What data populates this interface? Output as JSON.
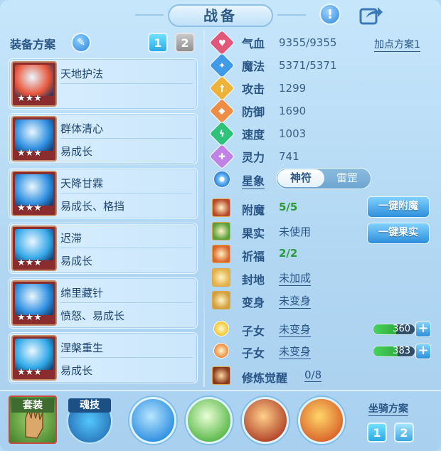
{
  "window": {
    "title": "战备"
  },
  "header": {
    "alert_icon": "exclamation-icon",
    "share_icon": "share-icon"
  },
  "left": {
    "scheme_label": "装备方案",
    "pages": [
      "1",
      "2"
    ],
    "skills": [
      {
        "name": "天地护法",
        "sub": "",
        "stars": "★★★",
        "color": "#e8553a"
      },
      {
        "name": "群体清心",
        "sub": "易成长",
        "stars": "★★★",
        "color": "#2f8fe0"
      },
      {
        "name": "天降甘霖",
        "sub": "易成长、格挡",
        "stars": "★★★",
        "color": "#2f8fe0"
      },
      {
        "name": "迟滞",
        "sub": "易成长",
        "stars": "★★★",
        "color": "#36a8e8"
      },
      {
        "name": "绵里藏针",
        "sub": "愤怒、易成长",
        "stars": "★★★",
        "color": "#2f8fe0"
      },
      {
        "name": "涅槃重生",
        "sub": "易成长",
        "stars": "★★★",
        "color": "#2fa8e8"
      }
    ]
  },
  "stats": {
    "plan_link": "加点方案1",
    "rows": [
      {
        "label": "气血",
        "value": "9355/9355",
        "color": "#e2587a",
        "glyph": "♥"
      },
      {
        "label": "魔法",
        "value": "5371/5371",
        "color": "#3f9ae8",
        "glyph": "✦"
      },
      {
        "label": "攻击",
        "value": "1299",
        "color": "#efb23a",
        "glyph": "†"
      },
      {
        "label": "防御",
        "value": "1690",
        "color": "#ee8d46",
        "glyph": "◆"
      },
      {
        "label": "速度",
        "value": "1003",
        "color": "#2fc27a",
        "glyph": "ϟ"
      },
      {
        "label": "灵力",
        "value": "741",
        "color": "#c184e6",
        "glyph": "✚"
      }
    ],
    "star": {
      "label": "星象",
      "opt_on": "神符",
      "opt_off": "雷罡"
    }
  },
  "extras": {
    "rows": [
      {
        "label": "附魔",
        "value": "5/5",
        "style": "green",
        "icon": "#b84a2a"
      },
      {
        "label": "果实",
        "value": "未使用",
        "style": "dark",
        "icon": "#5aa03a"
      },
      {
        "label": "祈福",
        "value": "2/2",
        "style": "green",
        "icon": "#d9652a"
      },
      {
        "label": "封地",
        "value": "未加成",
        "style": "ul",
        "icon": "#e3b24a"
      },
      {
        "label": "变身",
        "value": "未变身",
        "style": "ul",
        "icon": "#d2a03c"
      }
    ],
    "children": [
      {
        "label": "子女",
        "value": "未变身",
        "bar": "360",
        "fill": 0.55,
        "icon": "#f2c52c"
      },
      {
        "label": "子女",
        "value": "未变身",
        "bar": "383",
        "fill": 0.58,
        "icon": "#f0893a"
      }
    ],
    "cultivation": {
      "label": "修炼觉醒",
      "value": "0/8"
    },
    "btn_enchant": "一键附魔",
    "btn_fruit": "一键果实"
  },
  "bottom": {
    "suit_label": "套装",
    "soul_label": "魂技",
    "mount_label": "坐骑方案",
    "mount_pages": [
      "1",
      "2"
    ],
    "runes": [
      {
        "colors": [
          "#b6e6ff",
          "#2f8fe0"
        ]
      },
      {
        "colors": [
          "#e8ffd6",
          "#5bb84a"
        ]
      },
      {
        "colors": [
          "#ffd08a",
          "#b2452a"
        ]
      },
      {
        "colors": [
          "#ffd66a",
          "#d9652a"
        ]
      }
    ]
  }
}
